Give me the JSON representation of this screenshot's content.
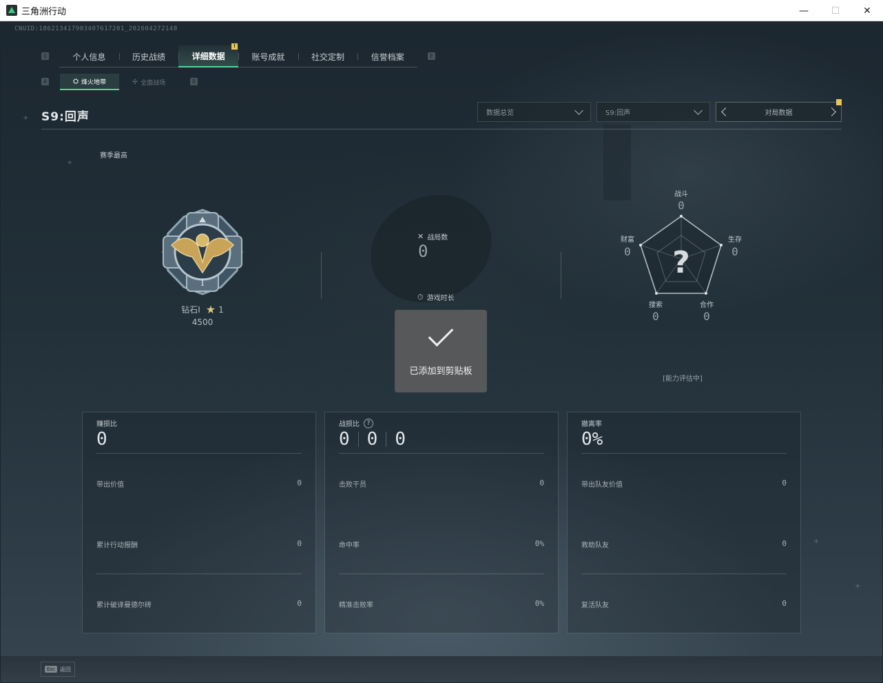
{
  "window": {
    "title": "三角洲行动",
    "controls": {
      "minimize": "—",
      "maximize": "☐",
      "close": "✕"
    }
  },
  "cnuid": "CNUID:186213417903407617201_202604272148",
  "key_hints": {
    "prev_tab": "Q",
    "next_tab": "E",
    "prev_sub": "A",
    "next_sub": "D"
  },
  "tabs": [
    {
      "label": "个人信息"
    },
    {
      "label": "历史战绩"
    },
    {
      "label": "详细数据",
      "active": true,
      "badge": "!"
    },
    {
      "label": "账号成就"
    },
    {
      "label": "社交定制"
    },
    {
      "label": "信誉档案"
    }
  ],
  "subtabs": [
    {
      "label": "烽火地带",
      "icon": "⛭",
      "active": true
    },
    {
      "label": "全面战场",
      "icon": "✢"
    }
  ],
  "header": {
    "season_title": "S9:回声",
    "dropdown_overview": "数据总览",
    "dropdown_season": "S9:回声",
    "pager_label": "对局数据"
  },
  "season_high": "赛季最高",
  "rank": {
    "name": "钻石I",
    "stars": "1",
    "score": "4500",
    "star_icon": "★"
  },
  "middle_stats": {
    "matches_label": "战局数",
    "matches_value": "0",
    "playtime_label": "游戏时长",
    "matches_icon": "✕",
    "playtime_icon": "⏱"
  },
  "radar": {
    "combat_label": "战斗",
    "combat_value": "0",
    "survival_label": "生存",
    "survival_value": "0",
    "teamwork_label": "合作",
    "teamwork_value": "0",
    "search_label": "搜索",
    "search_value": "0",
    "wealth_label": "财富",
    "wealth_value": "0",
    "center_mark": "?",
    "assessment": "[能力评估中]"
  },
  "toast": {
    "message": "已添加到剪贴板"
  },
  "cards": {
    "profit": {
      "label": "赚损比",
      "value": "0",
      "rows": [
        {
          "label": "带出价值",
          "value": "0"
        },
        {
          "label": "累计行动报酬",
          "value": "0"
        },
        {
          "label": "累计破译曼德尔砖",
          "value": "0"
        }
      ]
    },
    "kd": {
      "label": "战损比",
      "values": [
        "0",
        "0",
        "0"
      ],
      "help": "?",
      "rows": [
        {
          "label": "击败干员",
          "value": "0"
        },
        {
          "label": "命中率",
          "value": "0%"
        },
        {
          "label": "精准击败率",
          "value": "0%"
        }
      ]
    },
    "extract": {
      "label": "撤离率",
      "value": "0%",
      "rows": [
        {
          "label": "带出队友价值",
          "value": "0"
        },
        {
          "label": "救助队友",
          "value": "0"
        },
        {
          "label": "复活队友",
          "value": "0"
        }
      ]
    }
  },
  "bottom": {
    "esc_key": "Esc",
    "esc_label": "返回"
  }
}
